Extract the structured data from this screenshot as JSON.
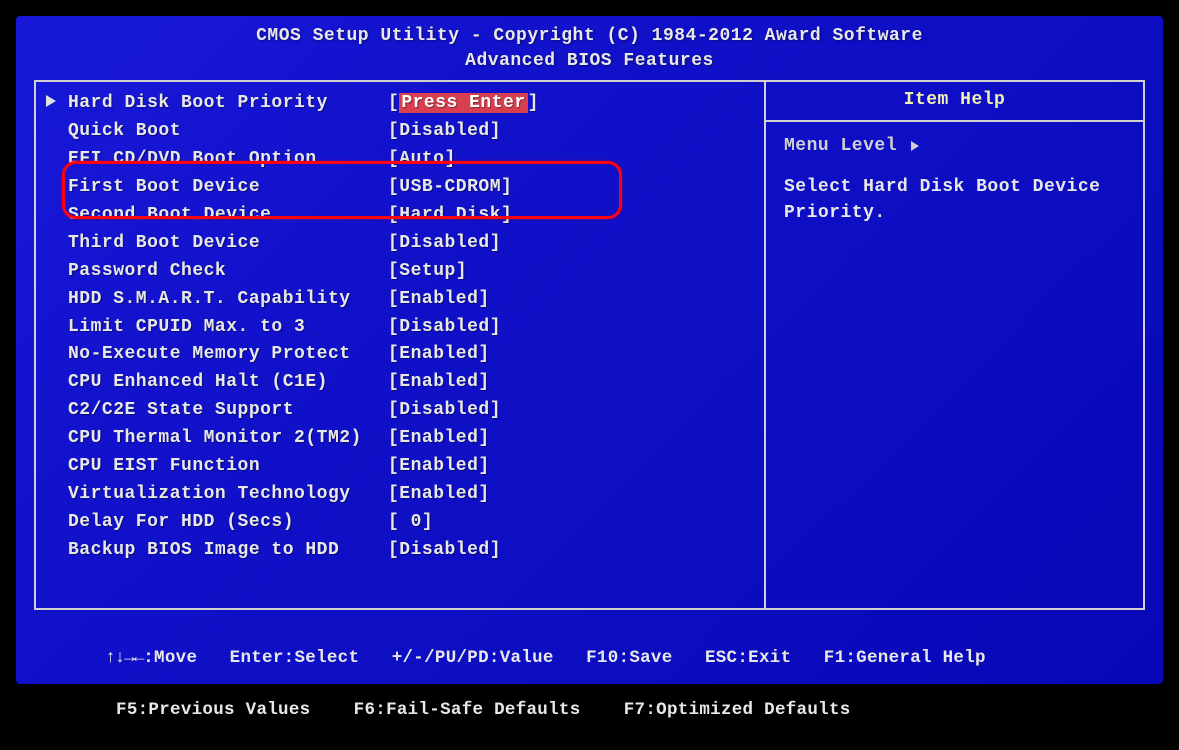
{
  "header": {
    "line1": "CMOS Setup Utility - Copyright (C) 1984-2012 Award Software",
    "line2": "Advanced BIOS Features"
  },
  "menu": [
    {
      "arrow": true,
      "label": "Hard Disk Boot Priority",
      "value": "Press Enter",
      "highlighted": true
    },
    {
      "arrow": false,
      "label": "Quick Boot",
      "value": "Disabled"
    },
    {
      "arrow": false,
      "label": "EFI CD/DVD Boot Option",
      "value": "Auto"
    },
    {
      "arrow": false,
      "label": "First Boot Device",
      "value": "USB-CDROM"
    },
    {
      "arrow": false,
      "label": "Second Boot Device",
      "value": "Hard Disk"
    },
    {
      "arrow": false,
      "label": "Third Boot Device",
      "value": "Disabled"
    },
    {
      "arrow": false,
      "label": "Password Check",
      "value": "Setup"
    },
    {
      "arrow": false,
      "label": "HDD S.M.A.R.T. Capability",
      "value": "Enabled"
    },
    {
      "arrow": false,
      "label": "Limit CPUID Max. to 3",
      "value": "Disabled"
    },
    {
      "arrow": false,
      "label": "No-Execute Memory Protect",
      "value": "Enabled"
    },
    {
      "arrow": false,
      "label": "CPU Enhanced Halt (C1E)",
      "value": "Enabled"
    },
    {
      "arrow": false,
      "label": "C2/C2E State Support",
      "value": "Disabled"
    },
    {
      "arrow": false,
      "label": "CPU Thermal Monitor 2(TM2)",
      "value": "Enabled"
    },
    {
      "arrow": false,
      "label": "CPU EIST Function",
      "value": "Enabled"
    },
    {
      "arrow": false,
      "label": "Virtualization Technology",
      "value": "Enabled"
    },
    {
      "arrow": false,
      "label": "Delay For HDD (Secs)",
      "value": " 0"
    },
    {
      "arrow": false,
      "label": "Backup BIOS Image to HDD",
      "value": "Disabled"
    }
  ],
  "help": {
    "title": "Item Help",
    "menu_level_label": "Menu Level",
    "description": "Select Hard Disk Boot Device Priority."
  },
  "footer": {
    "move": ":Move",
    "enter": "Enter:Select",
    "pupd": "+/-/PU/PD:Value",
    "f10": "F10:Save",
    "esc": "ESC:Exit",
    "f1": "F1:General Help",
    "f5": "F5:Previous Values",
    "f6": "F6:Fail-Safe Defaults",
    "f7": "F7:Optimized Defaults"
  },
  "annotation": {
    "highlighted_rows": [
      "EFI CD/DVD Boot Option",
      "First Boot Device",
      "Second Boot Device"
    ]
  }
}
